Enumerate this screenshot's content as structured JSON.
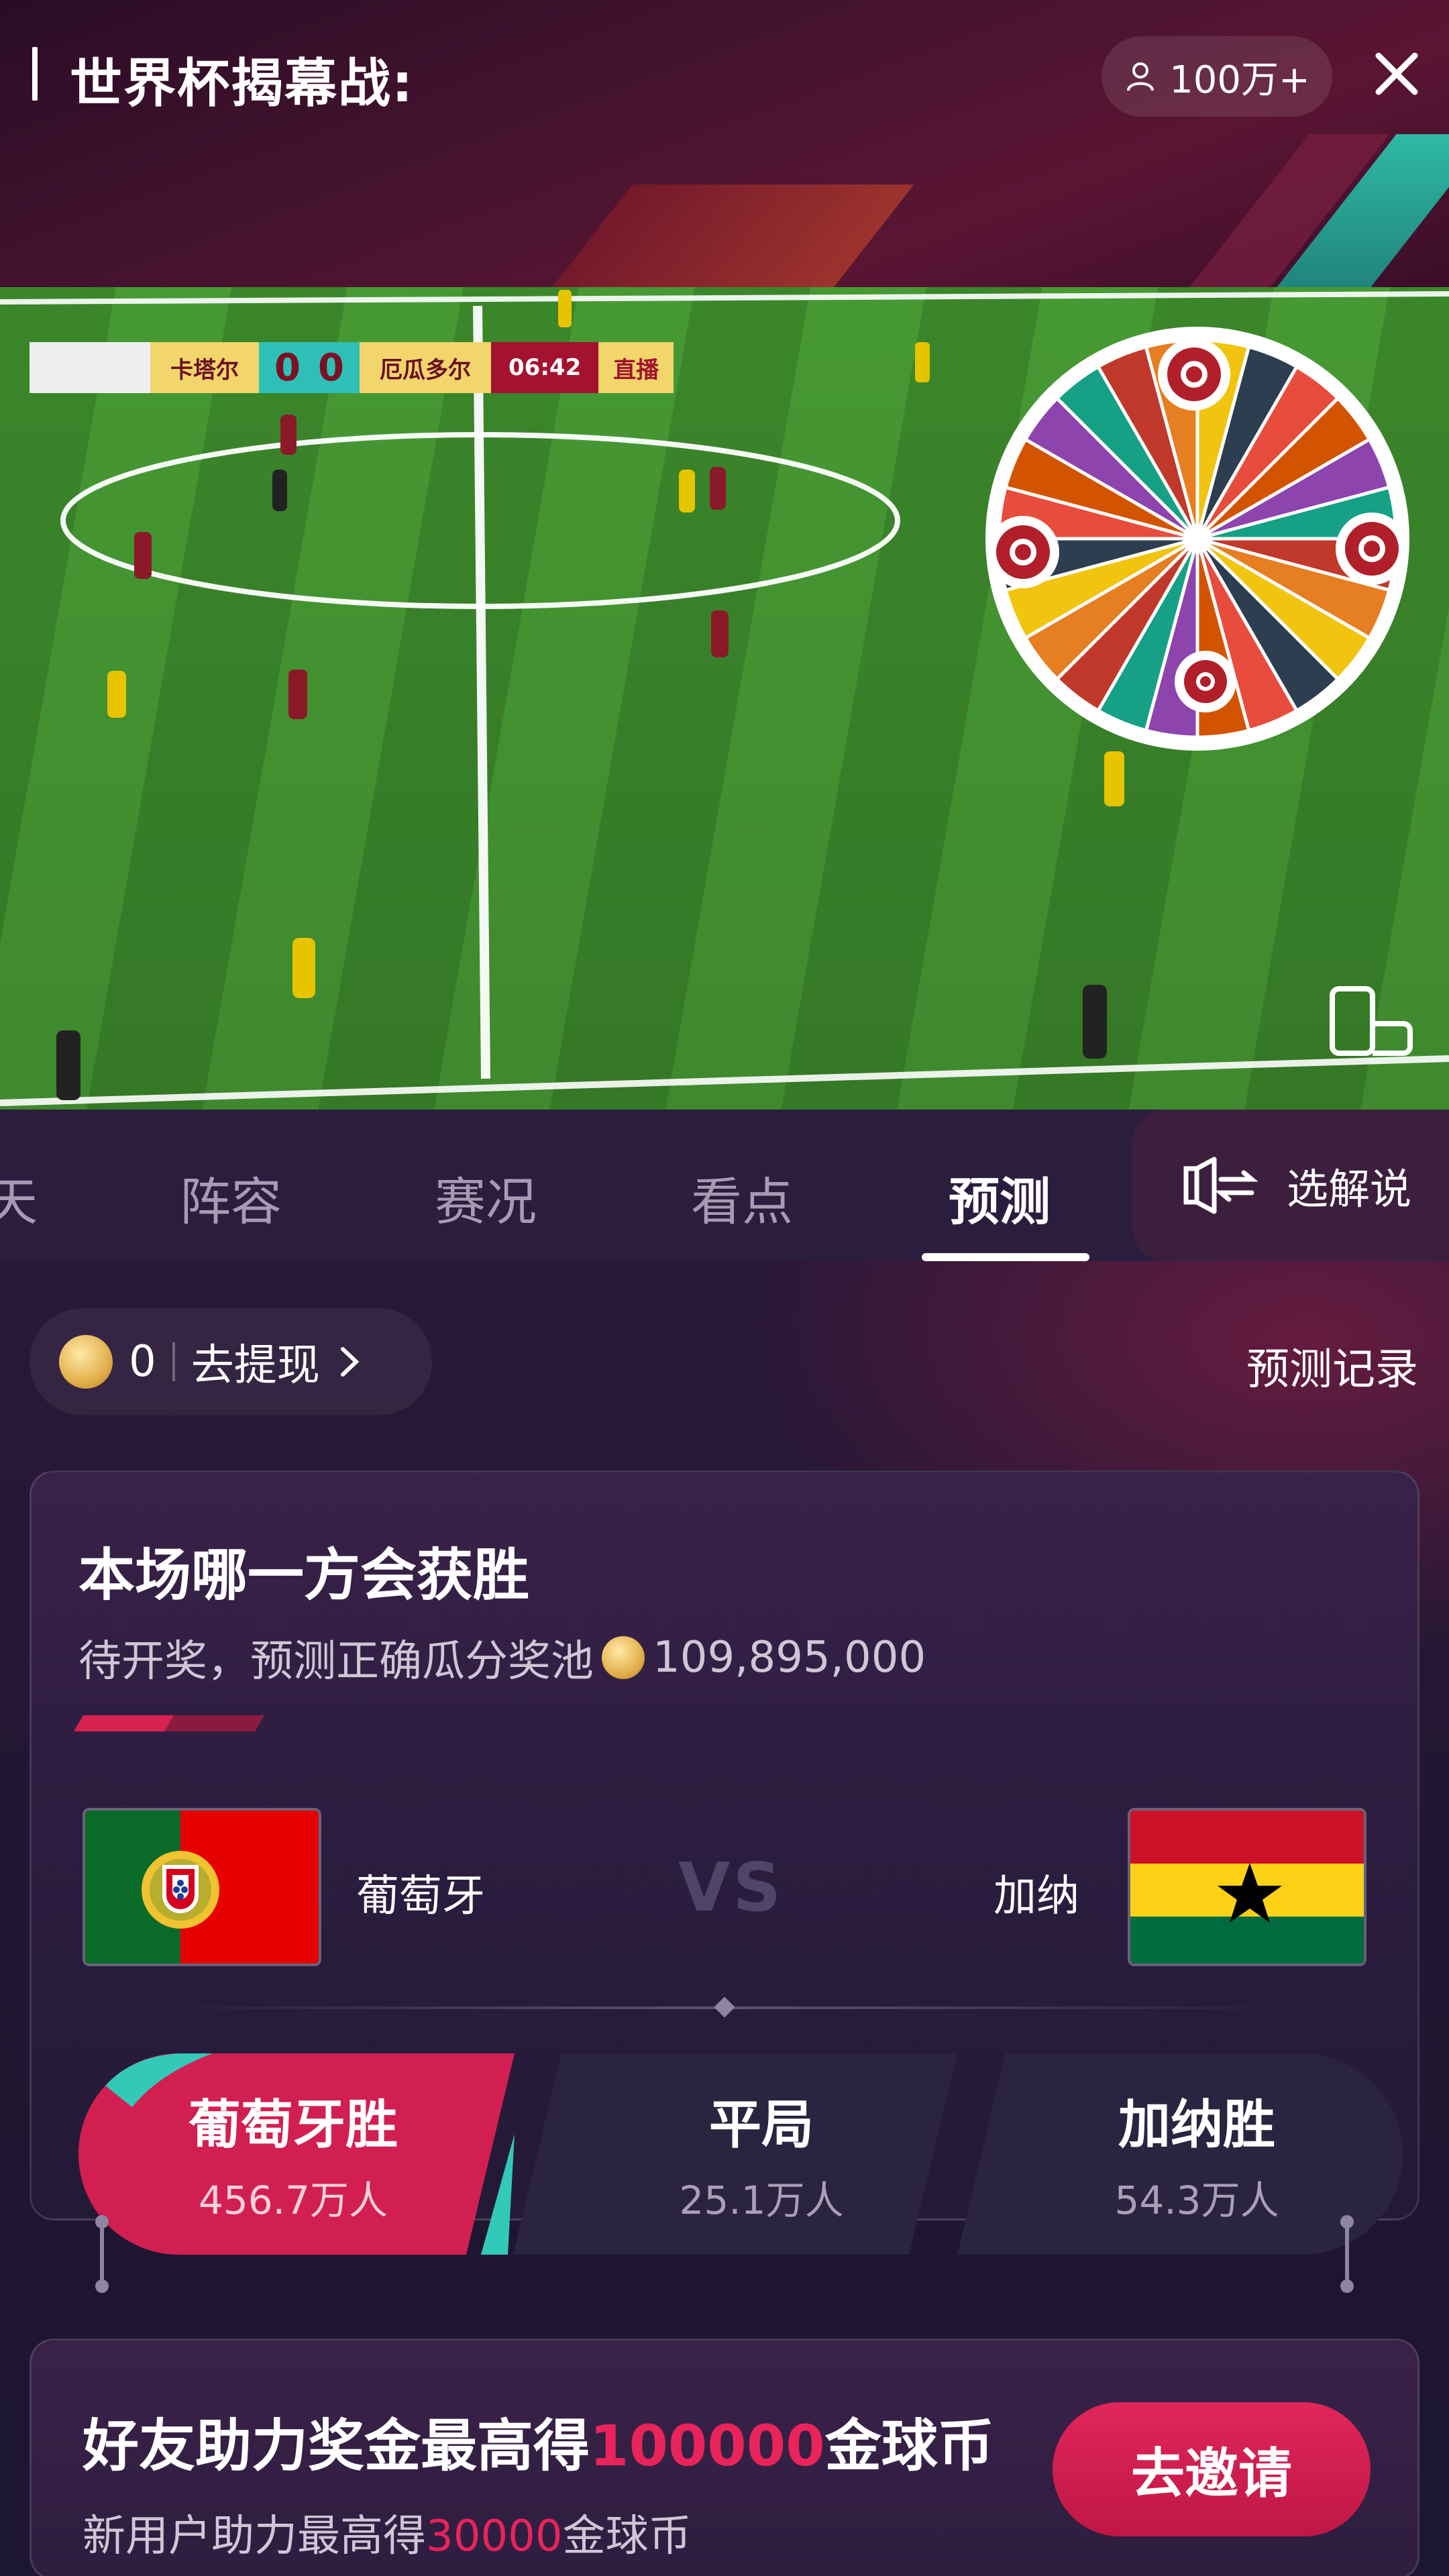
{
  "header": {
    "title": "世界杯揭幕战:",
    "viewers": "100万+"
  },
  "video": {
    "scoreboard": {
      "home_team": "卡塔尔",
      "home_score": "0",
      "away_score": "0",
      "away_team": "厄瓜多尔",
      "time": "06:42",
      "live": "直播"
    }
  },
  "tabs": {
    "items": [
      {
        "label": "天"
      },
      {
        "label": "阵容"
      },
      {
        "label": "赛况"
      },
      {
        "label": "看点"
      },
      {
        "label": "预测"
      }
    ],
    "active": "预测",
    "commentary_label": "选解说"
  },
  "wallet": {
    "coins": "0",
    "withdraw_label": "去提现",
    "record_label": "预测记录"
  },
  "prediction": {
    "title": "本场哪一方会获胜",
    "subtitle": "待开奖，预测正确瓜分奖池",
    "pool": "109,895,000",
    "home_team": "葡萄牙",
    "vs": "VS",
    "away_team": "加纳",
    "options": [
      {
        "label": "葡萄牙胜",
        "count": "456.7万人"
      },
      {
        "label": "平局",
        "count": "25.1万人"
      },
      {
        "label": "加纳胜",
        "count": "54.3万人"
      }
    ]
  },
  "invite": {
    "title_pre": "好友助力奖金最高得",
    "title_amount": "100000",
    "title_post": "金球币",
    "sub_pre": "新用户助力最高得",
    "sub_amount": "30000",
    "sub_post": "金球币",
    "button_label": "去邀请"
  },
  "colors": {
    "accent": "#e0265a",
    "teal": "#2fb9a4",
    "background": "#1c1630"
  }
}
